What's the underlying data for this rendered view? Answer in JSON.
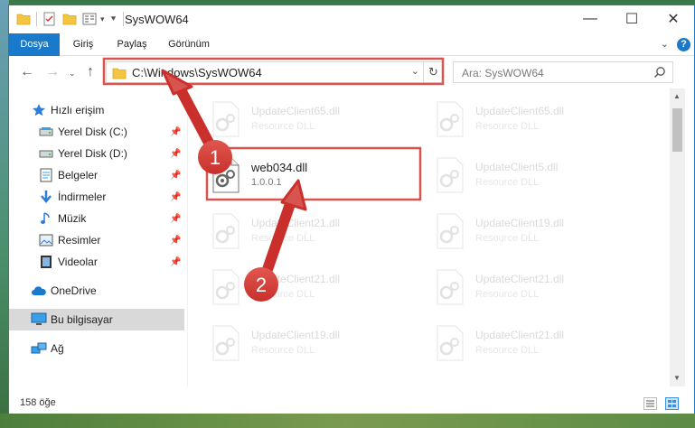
{
  "window": {
    "title": "SysWOW64",
    "minimize_glyph": "—",
    "maximize_glyph": "☐",
    "close_glyph": "✕"
  },
  "ribbon": {
    "tabs": [
      {
        "label": "Dosya"
      },
      {
        "label": "Giriş"
      },
      {
        "label": "Paylaş"
      },
      {
        "label": "Görünüm"
      }
    ],
    "help_glyph": "?"
  },
  "nav": {
    "address": "C:\\Windows\\SysWOW64",
    "search_placeholder": "Ara: SysWOW64"
  },
  "sidebar": {
    "items": [
      {
        "label": "Hızlı erişim",
        "icon": "star-icon",
        "pinned": false
      },
      {
        "label": "Yerel Disk (C:)",
        "icon": "drive-icon",
        "pinned": true
      },
      {
        "label": "Yerel Disk (D:)",
        "icon": "drive-icon",
        "pinned": true
      },
      {
        "label": "Belgeler",
        "icon": "documents-icon",
        "pinned": true
      },
      {
        "label": "İndirmeler",
        "icon": "download-icon",
        "pinned": true
      },
      {
        "label": "Müzik",
        "icon": "music-icon",
        "pinned": true
      },
      {
        "label": "Resimler",
        "icon": "pictures-icon",
        "pinned": true
      },
      {
        "label": "Videolar",
        "icon": "video-icon",
        "pinned": true
      },
      {
        "label": "OneDrive",
        "icon": "cloud-icon",
        "pinned": false
      },
      {
        "label": "Bu bilgisayar",
        "icon": "computer-icon",
        "pinned": false
      },
      {
        "label": "Ağ",
        "icon": "network-icon",
        "pinned": false
      }
    ]
  },
  "files": [
    {
      "name": "UpdateClient65.dll",
      "type": "Resource DLL",
      "faded": true
    },
    {
      "name": "UpdateClient65.dll",
      "type": "Resource DLL",
      "faded": true
    },
    {
      "name": "web034.dll",
      "type": "1.0.0.1",
      "faded": false
    },
    {
      "name": "UpdateClient5.dll",
      "type": "Resource DLL",
      "faded": true
    },
    {
      "name": "UpdateClient21.dll",
      "type": "Resource DLL",
      "faded": true
    },
    {
      "name": "UpdateClient19.dll",
      "type": "Resource DLL",
      "faded": true
    },
    {
      "name": "UpdateClient21.dll",
      "type": "Resource DLL",
      "faded": true
    },
    {
      "name": "UpdateClient21.dll",
      "type": "Resource DLL",
      "faded": true
    },
    {
      "name": "UpdateClient19.dll",
      "type": "Resource DLL",
      "faded": true
    },
    {
      "name": "UpdateClient21.dll",
      "type": "Resource DLL",
      "faded": true
    }
  ],
  "status": {
    "count_text": "158 öğe"
  },
  "annotations": {
    "step1": "1",
    "step2": "2",
    "color": "#d9534f"
  }
}
